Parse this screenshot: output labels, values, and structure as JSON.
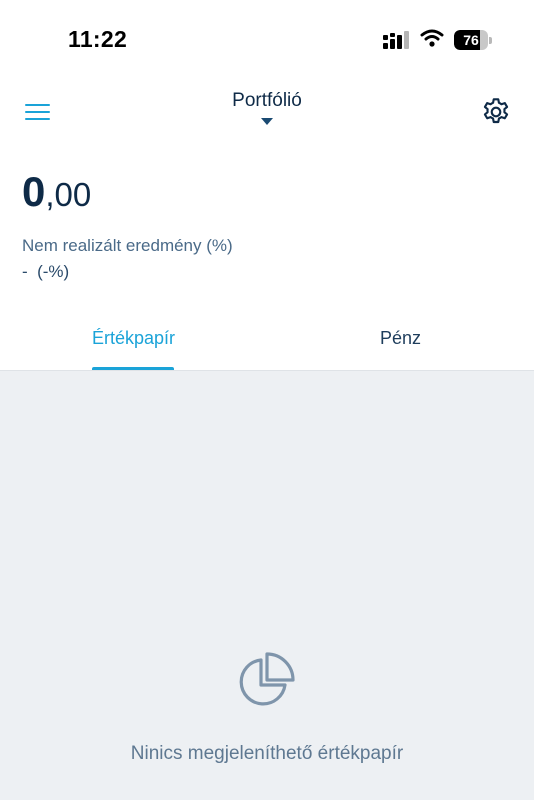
{
  "status_bar": {
    "time": "11:22",
    "battery_level": 76,
    "battery_label": "76",
    "icons": [
      "signal-icon",
      "wifi-icon",
      "battery-icon"
    ]
  },
  "header": {
    "title": "Portfólió",
    "icons": [
      "menu-icon",
      "dropdown-caret-icon",
      "gear-icon"
    ]
  },
  "balance": {
    "integer": "0",
    "decimal": ",00"
  },
  "unrealized": {
    "label": "Nem realizált eredmény (%)",
    "value": "-  (-%)"
  },
  "tabs": [
    {
      "label": "Értékpapír",
      "active": true
    },
    {
      "label": "Pénz",
      "active": false
    }
  ],
  "empty_state": {
    "icon": "pie-chart-icon",
    "message": "Ninics megjeleníthető értékpapír"
  },
  "colors": {
    "accent": "#1aa3d8",
    "navy": "#0e2a47",
    "content_bg": "#edf0f3",
    "muted": "#5e7891"
  }
}
